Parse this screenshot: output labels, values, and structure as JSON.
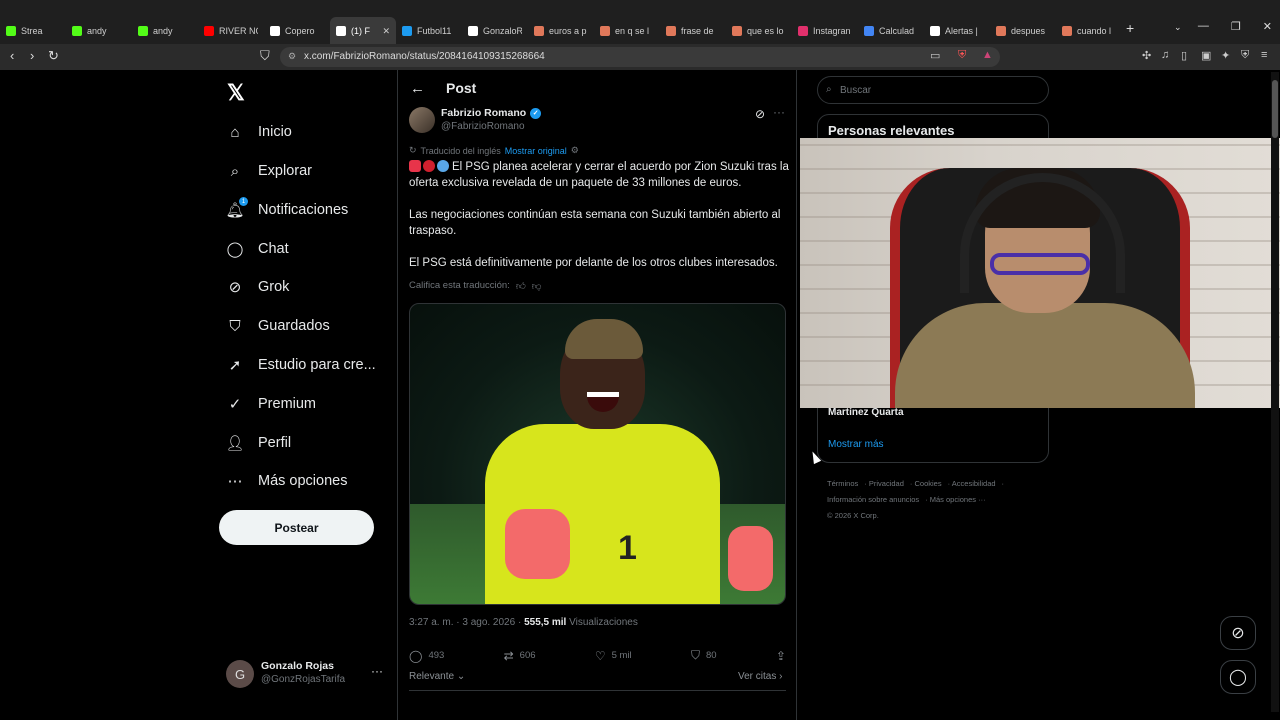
{
  "browser": {
    "tabs": [
      {
        "label": "Strea",
        "color": "#53fc18"
      },
      {
        "label": "andy",
        "color": "#53fc18"
      },
      {
        "label": "andy",
        "color": "#53fc18"
      },
      {
        "label": "RIVER NO",
        "color": "#ff0000"
      },
      {
        "label": "Copero",
        "color": "#ffffff"
      },
      {
        "label": "(1) F",
        "color": "#ffffff"
      },
      {
        "label": "Futbol11",
        "color": "#1d9bf0"
      },
      {
        "label": "GonzaloR",
        "color": "#ffffff"
      },
      {
        "label": "euros a p",
        "color": "#e0785a"
      },
      {
        "label": "en q se l",
        "color": "#e0785a"
      },
      {
        "label": "frase de",
        "color": "#e0785a"
      },
      {
        "label": "que es lo",
        "color": "#e0785a"
      },
      {
        "label": "Instagran",
        "color": "#e1306c"
      },
      {
        "label": "Calculad",
        "color": "#4285f4"
      },
      {
        "label": "Alertas |",
        "color": "#ffffff"
      },
      {
        "label": "despues",
        "color": "#e0785a"
      },
      {
        "label": "cuando l",
        "color": "#e0785a"
      }
    ],
    "url": "x.com/FabrizioRomano/status/2084164109315268664"
  },
  "nav": {
    "items": [
      {
        "label": "Inicio",
        "icon": "home-icon",
        "glyph": "⌂"
      },
      {
        "label": "Explorar",
        "icon": "search-icon",
        "glyph": "⌕"
      },
      {
        "label": "Notificaciones",
        "icon": "bell-icon",
        "glyph": "🔔︎"
      },
      {
        "label": "Chat",
        "icon": "chat-icon",
        "glyph": "◯"
      },
      {
        "label": "Grok",
        "icon": "grok-icon",
        "glyph": "⊘"
      },
      {
        "label": "Guardados",
        "icon": "bookmark-icon",
        "glyph": "⛉"
      },
      {
        "label": "Estudio para cre...",
        "icon": "rocket-icon",
        "glyph": "➚"
      },
      {
        "label": "Premium",
        "icon": "verified-icon",
        "glyph": "✓"
      },
      {
        "label": "Perfil",
        "icon": "person-icon",
        "glyph": "👤︎"
      },
      {
        "label": "Más opciones",
        "icon": "more-circle-icon",
        "glyph": "⋯"
      }
    ],
    "notif_badge": "1",
    "post_button": "Postear"
  },
  "account": {
    "initial": "G",
    "name": "Gonzalo Rojas",
    "handle": "@GonzRojasTarifa"
  },
  "post": {
    "header": "Post",
    "author": "Fabrizio Romano",
    "handle": "@FabrizioRomano",
    "translated_label": "Traducido del inglés",
    "show_original": "Mostrar original",
    "paragraph1": "El PSG planea acelerar y cerrar el acuerdo por Zion Suzuki tras la oferta exclusiva revelada de un paquete de 33 millones de euros.",
    "paragraph2": "Las negociaciones continúan esta semana con Suzuki también abierto al traspaso.",
    "paragraph3": "El PSG está definitivamente por delante de los otros clubes interesados.",
    "rate_label": "Califica esta traducción:",
    "time": "3:27 a. m. · 3 ago. 2026 ·",
    "views": "555,5 mil",
    "views_label": "Visualizaciones",
    "replies": "493",
    "reposts": "606",
    "likes": "5 mil",
    "bookmarks": "80",
    "sort_label": "Relevante",
    "quotes_label": "Ver citas"
  },
  "sidebar": {
    "search_placeholder": "Buscar",
    "relevant_title": "Personas relevantes",
    "person": "Martínez Quarta",
    "show_more": "Mostrar más",
    "footer": [
      "Términos",
      "Privacidad",
      "Cookies",
      "Accesibilidad",
      "Información sobre anuncios",
      "Más opciones ···",
      "© 2026 X Corp."
    ]
  },
  "colors": {
    "accent": "#1d9bf0",
    "background": "#000000",
    "text": "#e7e9ea",
    "muted": "#71767b"
  }
}
